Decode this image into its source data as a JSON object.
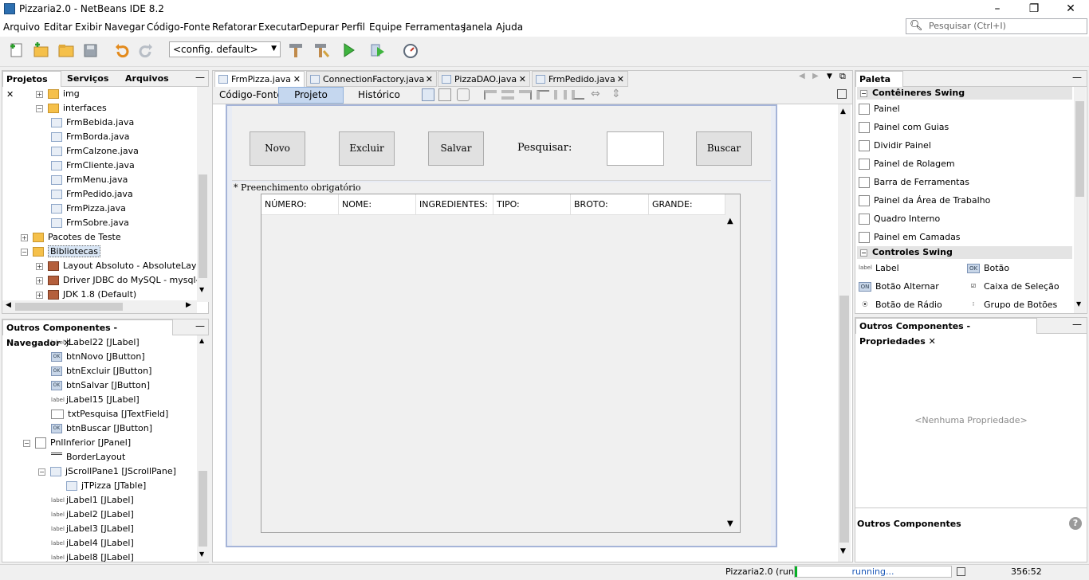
{
  "window": {
    "title": "Pizzaria2.0 - NetBeans IDE 8.2",
    "minimize": "–",
    "maximize": "❐",
    "close": "✕"
  },
  "menu": [
    "Arquivo",
    "Editar",
    "Exibir",
    "Navegar",
    "Código-Fonte",
    "Refatorar",
    "Executar",
    "Depurar",
    "Perfil",
    "Equipe",
    "Ferramentas",
    "Janela",
    "Ajuda"
  ],
  "search": {
    "placeholder": "Pesquisar (Ctrl+I)"
  },
  "toolbar": {
    "config": "<config. default>"
  },
  "projects": {
    "tabs": [
      "Projetos",
      "Serviços",
      "Arquivos"
    ],
    "minimize": "—",
    "tree": [
      {
        "label": "img",
        "kind": "folder",
        "indent": 2
      },
      {
        "label": "interfaces",
        "kind": "folder",
        "indent": 2
      },
      {
        "label": "FrmBebida.java",
        "kind": "java",
        "indent": 3
      },
      {
        "label": "FrmBorda.java",
        "kind": "java",
        "indent": 3
      },
      {
        "label": "FrmCalzone.java",
        "kind": "java",
        "indent": 3
      },
      {
        "label": "FrmCliente.java",
        "kind": "java",
        "indent": 3
      },
      {
        "label": "FrmMenu.java",
        "kind": "java",
        "indent": 3
      },
      {
        "label": "FrmPedido.java",
        "kind": "java",
        "indent": 3
      },
      {
        "label": "FrmPizza.java",
        "kind": "java",
        "indent": 3
      },
      {
        "label": "FrmSobre.java",
        "kind": "java",
        "indent": 3
      },
      {
        "label": "Pacotes de Teste",
        "kind": "folder",
        "indent": 1
      },
      {
        "label": "Bibliotecas",
        "kind": "folder",
        "indent": 1
      },
      {
        "label": "Layout Absoluto - AbsoluteLayou",
        "kind": "lib",
        "indent": 2
      },
      {
        "label": "Driver JDBC do MySQL - mysql-co",
        "kind": "lib",
        "indent": 2
      },
      {
        "label": "JDK 1.8 (Default)",
        "kind": "lib",
        "indent": 2
      }
    ]
  },
  "navigator": {
    "title": "Outros Componentes - Navegador",
    "minimize": "—",
    "items": [
      {
        "label": "jLabel22 [JLabel]",
        "kind": "label",
        "indent": 3
      },
      {
        "label": "btnNovo [JButton]",
        "kind": "button",
        "indent": 3
      },
      {
        "label": "btnExcluir [JButton]",
        "kind": "button",
        "indent": 3
      },
      {
        "label": "btnSalvar [JButton]",
        "kind": "button",
        "indent": 3
      },
      {
        "label": "jLabel15 [JLabel]",
        "kind": "label",
        "indent": 3
      },
      {
        "label": "txtPesquisa [JTextField]",
        "kind": "field",
        "indent": 3
      },
      {
        "label": "btnBuscar [JButton]",
        "kind": "button",
        "indent": 3
      },
      {
        "label": "PnlInferior [JPanel]",
        "kind": "panel",
        "indent": 2
      },
      {
        "label": "BorderLayout",
        "kind": "layout",
        "indent": 3
      },
      {
        "label": "jScrollPane1 [JScrollPane]",
        "kind": "scroll",
        "indent": 3
      },
      {
        "label": "jTPizza [JTable]",
        "kind": "table",
        "indent": 4
      },
      {
        "label": "jLabel1 [JLabel]",
        "kind": "label",
        "indent": 3
      },
      {
        "label": "jLabel2 [JLabel]",
        "kind": "label",
        "indent": 3
      },
      {
        "label": "jLabel3 [JLabel]",
        "kind": "label",
        "indent": 3
      },
      {
        "label": "jLabel4 [JLabel]",
        "kind": "label",
        "indent": 3
      },
      {
        "label": "jLabel8 [JLabel]",
        "kind": "label",
        "indent": 3
      }
    ]
  },
  "editor": {
    "tabs": [
      {
        "label": "FrmPizza.java",
        "active": true
      },
      {
        "label": "ConnectionFactory.java",
        "active": false
      },
      {
        "label": "PizzaDAO.java",
        "active": false
      },
      {
        "label": "FrmPedido.java",
        "active": false
      }
    ],
    "tab_close": "✕",
    "views": [
      "Código-Fonte",
      "Projeto",
      "Histórico"
    ],
    "active_view": "Projeto"
  },
  "form": {
    "buttons": {
      "novo": "Novo",
      "excluir": "Excluir",
      "salvar": "Salvar",
      "buscar": "Buscar"
    },
    "search_label": "Pesquisar:",
    "required_note": "* Preenchimento obrigatório",
    "table_columns": [
      "NÚMERO:",
      "NOME:",
      "INGREDIENTES:",
      "TIPO:",
      "BROTO:",
      "GRANDE:"
    ]
  },
  "palette": {
    "title": "Paleta",
    "minimize": "—",
    "sections": [
      {
        "title": "Contêineres Swing",
        "items": [
          "Painel",
          "Painel com Guias",
          "Dividir Painel",
          "Painel de Rolagem",
          "Barra de Ferramentas",
          "Painel da Área de Trabalho",
          "Quadro Interno",
          "Painel em Camadas"
        ]
      },
      {
        "title": "Controles Swing",
        "items": [
          "Label",
          "Botão",
          "Botão Alternar",
          "Caixa de Seleção",
          "Botão de Rádio",
          "Grupo de Botões"
        ]
      }
    ]
  },
  "properties": {
    "title": "Outros Componentes - Propriedades",
    "minimize": "—",
    "empty": "<Nenhuma Propriedade>",
    "footer": "Outros Componentes",
    "help": "?"
  },
  "status": {
    "project": "Pizzaria2.0 (run)",
    "progress": "running...",
    "position": "356:52"
  }
}
